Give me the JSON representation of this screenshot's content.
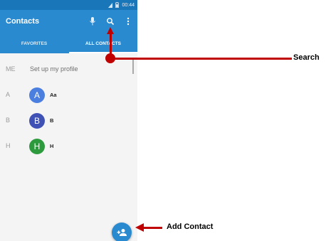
{
  "status_bar": {
    "time": "00:44"
  },
  "app_bar": {
    "title": "Contacts",
    "icons": [
      "mic-icon",
      "search-icon",
      "overflow-menu-icon"
    ]
  },
  "tabs": [
    {
      "label": "FAVORITES",
      "selected": false
    },
    {
      "label": "ALL CONTACTS",
      "selected": true
    }
  ],
  "me_row": {
    "letter": "ME",
    "text": "Set up my profile"
  },
  "contacts": [
    {
      "section": "A",
      "avatar_letter": "A",
      "name": "Aa",
      "color": "#4a7fe0"
    },
    {
      "section": "B",
      "avatar_letter": "B",
      "name": "B",
      "color": "#3f51b5"
    },
    {
      "section": "H",
      "avatar_letter": "H",
      "name": "H",
      "color": "#2e9a3e"
    }
  ],
  "fab": {
    "icon": "add-person-icon"
  },
  "annotations": {
    "search_label": "Search",
    "add_contact_label": "Add Contact",
    "color": "#c00000"
  },
  "colors": {
    "primary": "#2a8ad0",
    "status_bar": "#1976b9"
  }
}
